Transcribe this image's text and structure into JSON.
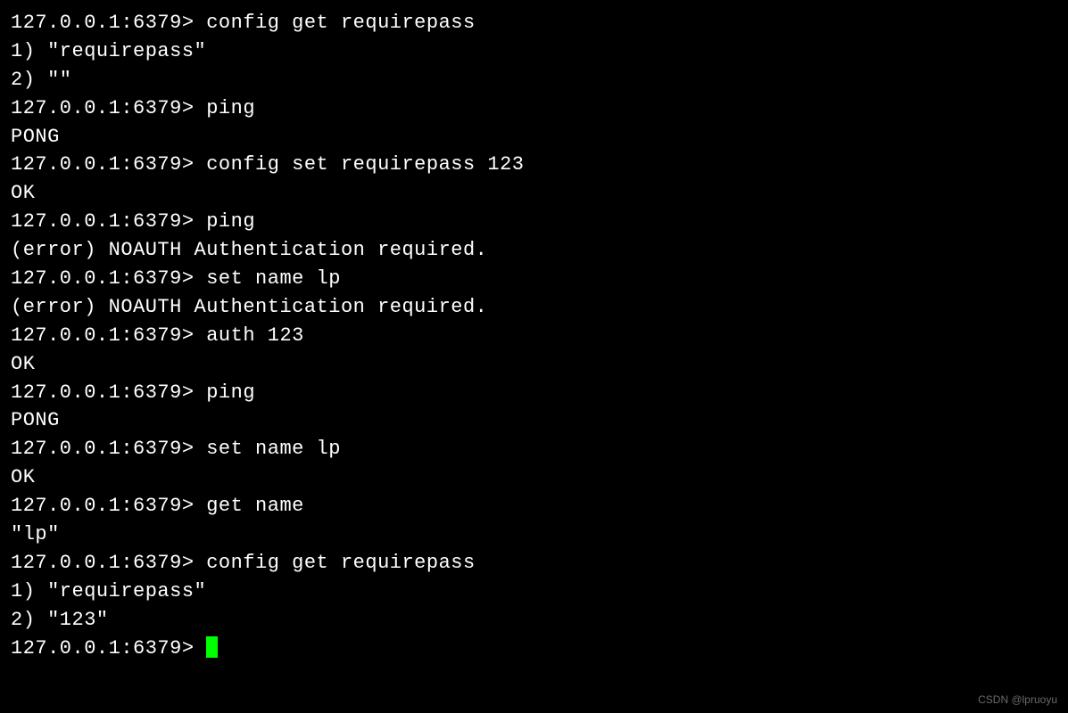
{
  "terminal": {
    "prompt": "127.0.0.1:6379> ",
    "lines": [
      {
        "type": "cmd",
        "text": "config get requirepass"
      },
      {
        "type": "out",
        "text": "1) \"requirepass\""
      },
      {
        "type": "out",
        "text": "2) \"\""
      },
      {
        "type": "cmd",
        "text": "ping"
      },
      {
        "type": "out",
        "text": "PONG"
      },
      {
        "type": "cmd",
        "text": "config set requirepass 123"
      },
      {
        "type": "out",
        "text": "OK"
      },
      {
        "type": "cmd",
        "text": "ping"
      },
      {
        "type": "out",
        "text": "(error) NOAUTH Authentication required."
      },
      {
        "type": "cmd",
        "text": "set name lp"
      },
      {
        "type": "out",
        "text": "(error) NOAUTH Authentication required."
      },
      {
        "type": "cmd",
        "text": "auth 123"
      },
      {
        "type": "out",
        "text": "OK"
      },
      {
        "type": "cmd",
        "text": "ping"
      },
      {
        "type": "out",
        "text": "PONG"
      },
      {
        "type": "cmd",
        "text": "set name lp"
      },
      {
        "type": "out",
        "text": "OK"
      },
      {
        "type": "cmd",
        "text": "get name"
      },
      {
        "type": "out",
        "text": "\"lp\""
      },
      {
        "type": "cmd",
        "text": "config get requirepass"
      },
      {
        "type": "out",
        "text": "1) \"requirepass\""
      },
      {
        "type": "out",
        "text": "2) \"123\""
      },
      {
        "type": "cmd",
        "text": "",
        "cursor": true
      }
    ]
  },
  "watermark": "CSDN @lpruoyu"
}
